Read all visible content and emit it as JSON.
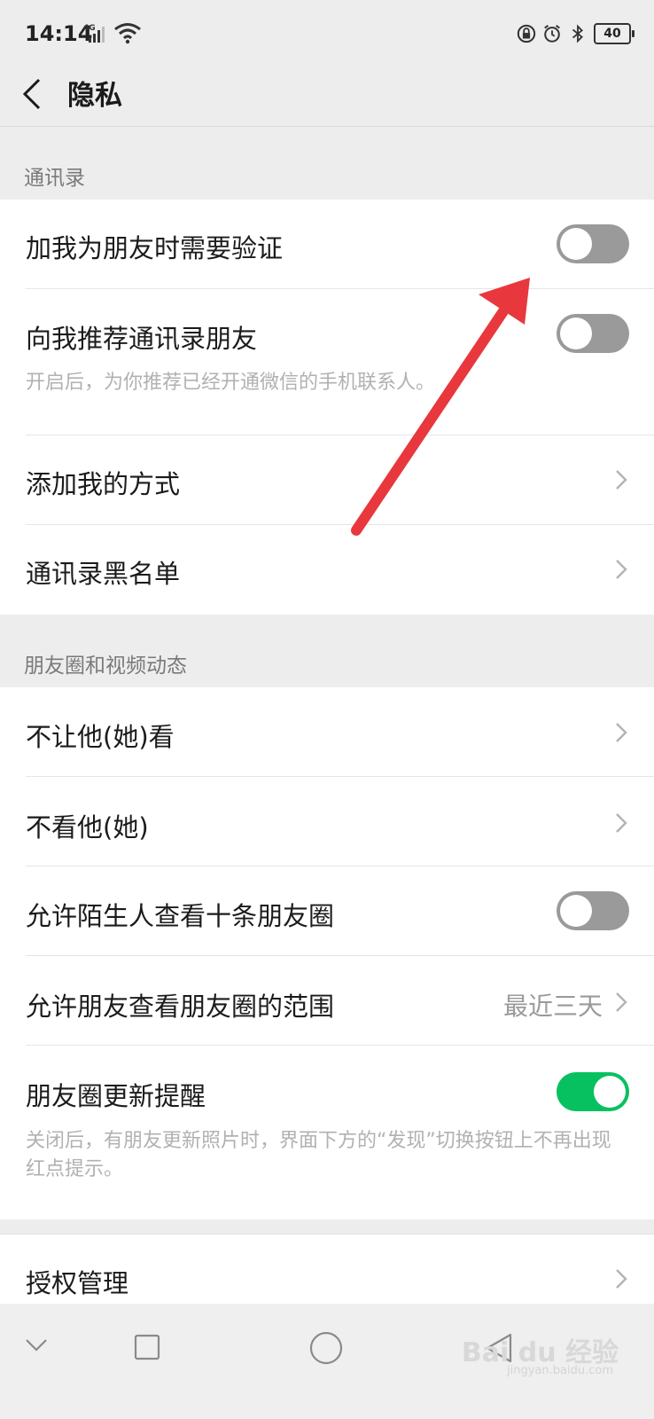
{
  "status_bar": {
    "time": "14:14",
    "network": "4G",
    "battery": "40",
    "icons": [
      "lock-rotation-icon",
      "alarm-icon",
      "bluetooth-icon"
    ]
  },
  "navbar": {
    "back_icon": "chevron-left-icon",
    "title": "隐私"
  },
  "sections": {
    "contacts_header": "通讯录",
    "moments_header": "朋友圈和视频动态"
  },
  "contacts": {
    "verify_label": "加我为朋友时需要验证",
    "verify_on": false,
    "recommend_label": "向我推荐通讯录朋友",
    "recommend_on": false,
    "recommend_desc": "开启后，为你推荐已经开通微信的手机联系人。",
    "add_methods_label": "添加我的方式",
    "blacklist_label": "通讯录黑名单"
  },
  "moments": {
    "hide_from_label": "不让他(她)看",
    "dont_see_label": "不看他(她)",
    "strangers_label": "允许陌生人查看十条朋友圈",
    "strangers_on": false,
    "range_label": "允许朋友查看朋友圈的范围",
    "range_value": "最近三天",
    "update_label": "朋友圈更新提醒",
    "update_on": true,
    "update_desc": "关闭后，有朋友更新照片时，界面下方的“发现”切换按钮上不再出现红点提示。"
  },
  "auth": {
    "label": "授权管理"
  },
  "system_nav": {
    "icons": [
      "chevron-down-icon",
      "square-icon",
      "circle-icon",
      "triangle-back-icon"
    ]
  },
  "annotation": {
    "arrow_color": "#e8383d"
  },
  "colors": {
    "toggle_on": "#07c160",
    "toggle_off": "#9a9a9a",
    "background": "#ededed"
  },
  "watermark": {
    "text": "Bai du 经验",
    "sub": "jingyan.baidu.com"
  }
}
